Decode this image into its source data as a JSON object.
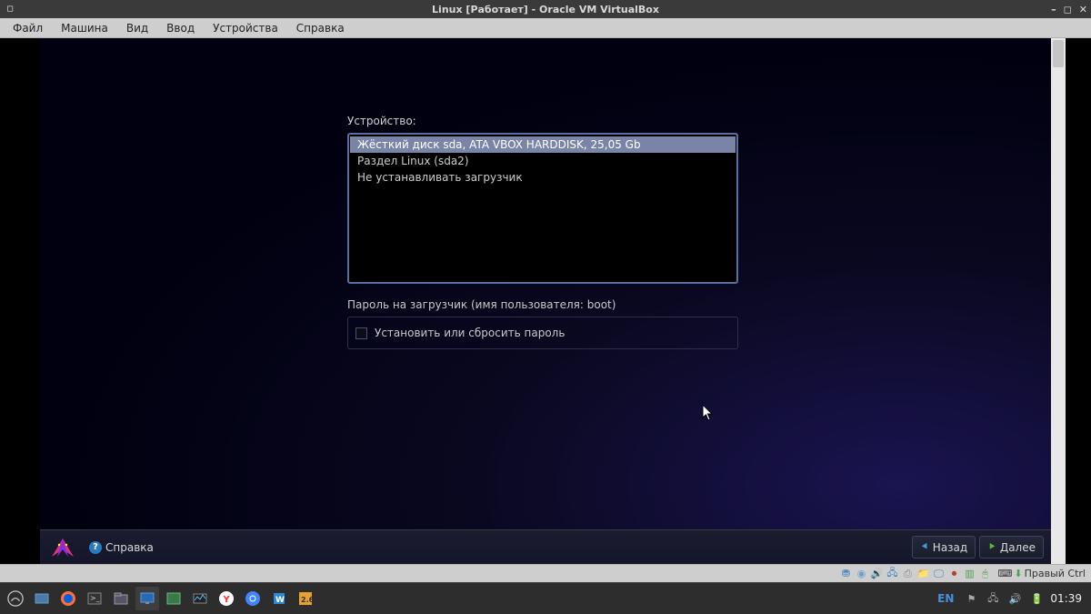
{
  "window": {
    "title": "Linux [Работает] - Oracle VM VirtualBox",
    "menu": [
      "Файл",
      "Машина",
      "Вид",
      "Ввод",
      "Устройства",
      "Справка"
    ]
  },
  "installer": {
    "device_label": "Устройство:",
    "devices": [
      "Жёсткий диск sda, ATA VBOX HARDDISK, 25,05 Gb",
      "Раздел Linux (sda2)",
      "Не устанавливать загрузчик"
    ],
    "selected_device_index": 0,
    "password_section_label": "Пароль на загрузчик (имя пользователя: boot)",
    "password_checkbox_label": "Установить или сбросить пароль",
    "password_checkbox_checked": false,
    "help_label": "Справка",
    "back_label": "Назад",
    "next_label": "Далее"
  },
  "vb_status": {
    "capture_key": "Правый Ctrl"
  },
  "taskbar": {
    "lang": "EN",
    "time": "01:39"
  }
}
